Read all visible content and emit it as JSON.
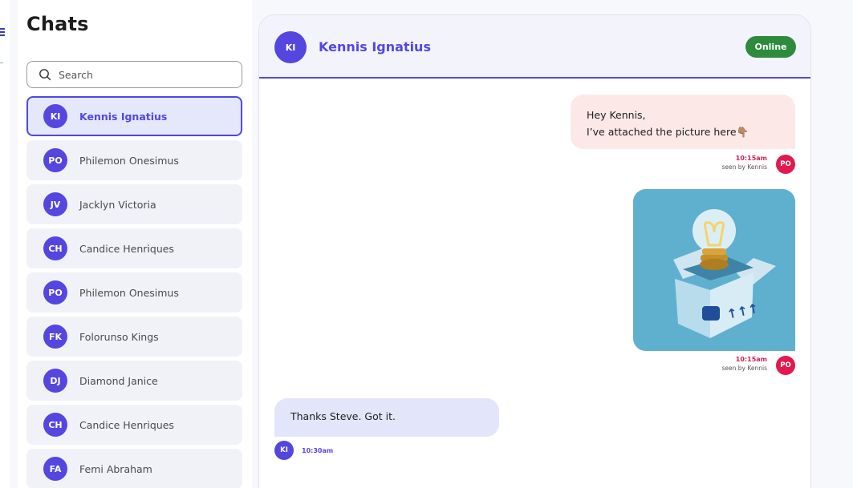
{
  "sidebar": {
    "title": "Chats",
    "search": {
      "placeholder": "Search",
      "value": ""
    },
    "contacts": [
      {
        "initials": "KI",
        "name": "Kennis Ignatius",
        "active": true
      },
      {
        "initials": "PO",
        "name": "Philemon Onesimus",
        "active": false
      },
      {
        "initials": "JV",
        "name": "Jacklyn Victoria",
        "active": false
      },
      {
        "initials": "CH",
        "name": "Candice Henriques",
        "active": false
      },
      {
        "initials": "PO",
        "name": "Philemon Onesimus",
        "active": false
      },
      {
        "initials": "FK",
        "name": "Folorunso Kings",
        "active": false
      },
      {
        "initials": "DJ",
        "name": "Diamond Janice",
        "active": false
      },
      {
        "initials": "CH",
        "name": "Candice Henriques",
        "active": false
      },
      {
        "initials": "FA",
        "name": "Femi Abraham",
        "active": false
      }
    ]
  },
  "chat": {
    "header": {
      "initials": "KI",
      "name": "Kennis Ignatius",
      "status": "Online"
    },
    "messages": [
      {
        "direction": "outgoing",
        "lines": [
          "Hey Kennis,",
          "I’ve attached the picture here👇🏽"
        ],
        "time": "10:15am",
        "seen": "seen by Kennis",
        "sender_initials": "PO"
      },
      {
        "direction": "outgoing",
        "attachment": "lightbulb-box-image",
        "time": "10:15am",
        "seen": "seen by Kennis",
        "sender_initials": "PO"
      },
      {
        "direction": "incoming",
        "text": "Thanks Steve. Got it.",
        "time": "10:30am",
        "sender_initials": "KI"
      }
    ]
  },
  "colors": {
    "accent": "#5147e5",
    "online": "#2e8b3e",
    "outgoing_bubble": "#fde8e8",
    "incoming_bubble": "#e3e6fb",
    "po_avatar": "#e2184f"
  }
}
